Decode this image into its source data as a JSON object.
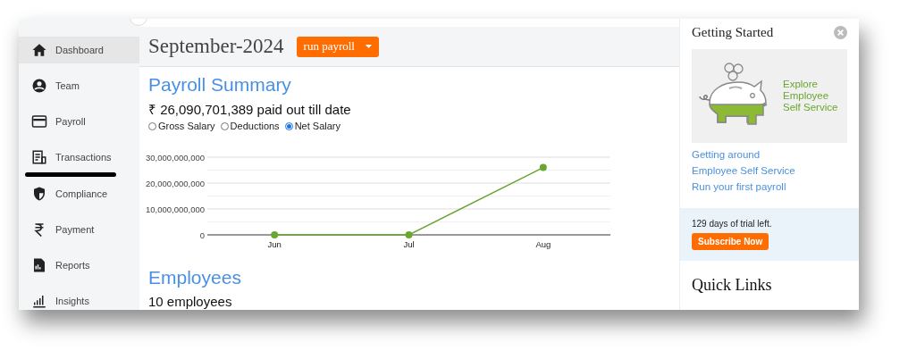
{
  "sidebar": {
    "items": [
      {
        "label": "Dashboard",
        "selected": true
      },
      {
        "label": "Team",
        "selected": false
      },
      {
        "label": "Payroll",
        "selected": false
      },
      {
        "label": "Transactions",
        "selected": false
      },
      {
        "label": "Compliance",
        "selected": false
      },
      {
        "label": "Payment",
        "selected": false
      },
      {
        "label": "Reports",
        "selected": false
      },
      {
        "label": "Insights",
        "selected": false
      }
    ]
  },
  "header": {
    "title": "September-2024",
    "run_button": "run payroll"
  },
  "payroll_summary": {
    "title": "Payroll Summary",
    "total": "₹ 26,090,701,389 paid out till date",
    "options": [
      {
        "label": "Gross Salary",
        "selected": false
      },
      {
        "label": "Deductions",
        "selected": false
      },
      {
        "label": "Net Salary",
        "selected": true
      }
    ],
    "chart_data": {
      "type": "line",
      "categories": [
        "Jun",
        "Jul",
        "Aug"
      ],
      "series": [
        {
          "color": "#6aa630",
          "marker": "circle",
          "values": [
            0,
            0,
            26000000000
          ]
        }
      ],
      "ylim": [
        0,
        30000000000
      ],
      "yticks": [
        {
          "value": 0,
          "label": "0"
        },
        {
          "value": 10000000000,
          "label": "10,000,000,000"
        },
        {
          "value": 20000000000,
          "label": "20,000,000,000"
        },
        {
          "value": 30000000000,
          "label": "30,000,000,000"
        }
      ]
    }
  },
  "employees": {
    "title": "Employees",
    "count": "10 employees"
  },
  "getting_started": {
    "title": "Getting Started",
    "banner_text": "Explore Employee Self Service",
    "links": [
      "Getting around",
      "Employee Self Service",
      "Run your first payroll"
    ],
    "trial_text": "129 days of trial left.",
    "subscribe_button": "Subscribe Now"
  },
  "quick_links": {
    "title": "Quick Links"
  }
}
